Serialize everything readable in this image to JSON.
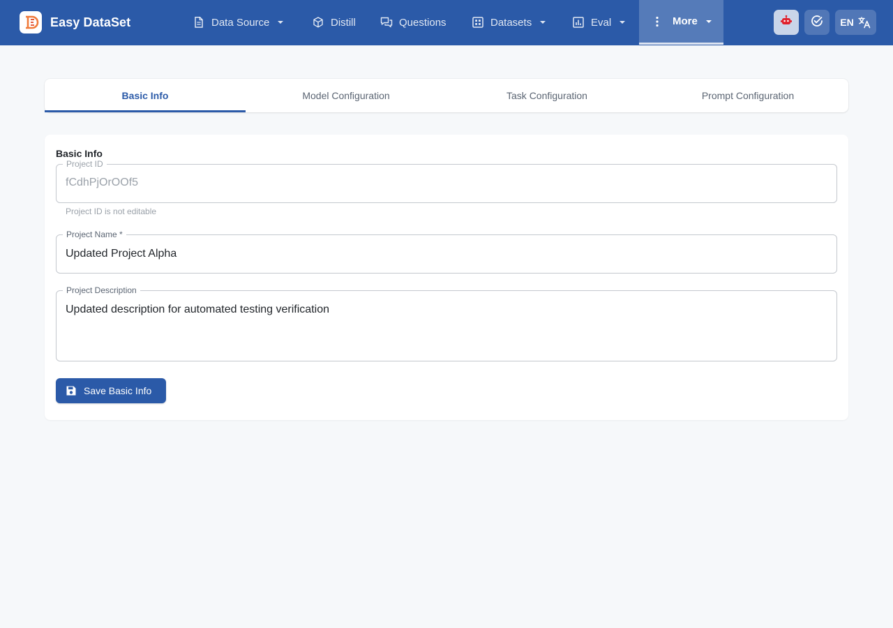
{
  "app": {
    "name": "Easy DataSet"
  },
  "nav": {
    "items": [
      {
        "label": "Data Source",
        "icon": "document-icon",
        "has_menu": true
      },
      {
        "label": "Distill",
        "icon": "cube-icon",
        "has_menu": false
      },
      {
        "label": "Questions",
        "icon": "chat-icon",
        "has_menu": false
      },
      {
        "label": "Datasets",
        "icon": "grid-icon",
        "has_menu": true
      },
      {
        "label": "Eval",
        "icon": "bar-chart-icon",
        "has_menu": true
      },
      {
        "label": "More",
        "icon": "more-vertical-icon",
        "has_menu": true,
        "active": true
      }
    ],
    "language": "EN"
  },
  "tabs": [
    {
      "label": "Basic Info",
      "active": true
    },
    {
      "label": "Model Configuration",
      "active": false
    },
    {
      "label": "Task Configuration",
      "active": false
    },
    {
      "label": "Prompt Configuration",
      "active": false
    }
  ],
  "basic_info": {
    "title": "Basic Info",
    "project_id": {
      "label": "Project ID",
      "value": "fCdhPjOrOOf5",
      "helper": "Project ID is not editable"
    },
    "project_name": {
      "label": "Project Name *",
      "value": "Updated Project Alpha"
    },
    "project_description": {
      "label": "Project Description",
      "value": "Updated description for automated testing verification"
    },
    "save_label": "Save Basic Info"
  },
  "colors": {
    "primary": "#2b5aa8",
    "background": "#f6f8fa",
    "robot_accent": "#e0202c",
    "logo_orange": "#f07a3a"
  }
}
